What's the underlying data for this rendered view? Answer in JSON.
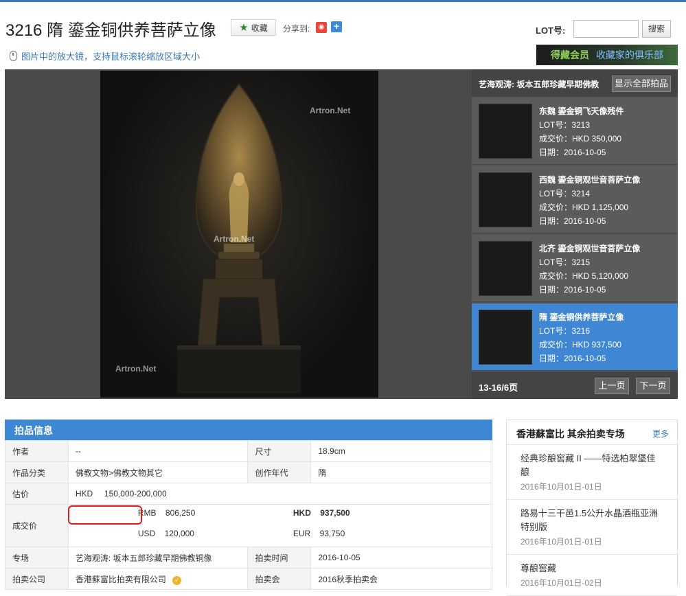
{
  "header": {
    "title": "3216 隋 鎏金铜供养菩萨立像",
    "fav_label": "收藏",
    "share_label": "分享到:",
    "lot_label": "LOT号:",
    "lot_value": "",
    "search_label": "搜索",
    "zoom_tip": "图片中的放大镜，支持鼠标滚轮缩放区域大小",
    "club_a": "得藏会员",
    "club_b": "收藏家的俱乐部"
  },
  "gallery": {
    "watermark": "Artron.Net",
    "side_title": "艺海观涛: 坂本五郎珍藏早期佛教",
    "show_all": "显示全部拍品",
    "items": [
      {
        "title": "东魏  鎏金铜飞天像残件",
        "lot": "LOT号：3213",
        "price": "成交价：HKD 350,000",
        "date": "日期：2016-10-05"
      },
      {
        "title": "西魏  鎏金铜观世音菩萨立像",
        "lot": "LOT号：3214",
        "price": "成交价：HKD 1,125,000",
        "date": "日期：2016-10-05"
      },
      {
        "title": "北齐  鎏金铜观世音菩萨立像",
        "lot": "LOT号：3215",
        "price": "成交价：HKD 5,120,000",
        "date": "日期：2016-10-05"
      },
      {
        "title": "隋  鎏金铜供养菩萨立像",
        "lot": "LOT号：3216",
        "price": "成交价：HKD 937,500",
        "date": "日期：2016-10-05"
      }
    ],
    "pager": "13-16/6页",
    "prev": "上一页",
    "next": "下一页"
  },
  "info": {
    "head": "拍品信息",
    "author_k": "作者",
    "author_v": "--",
    "size_k": "尺寸",
    "size_v": "18.9cm",
    "cat_k": "作品分类",
    "cat_v": "佛教文物>佛教文物其它",
    "era_k": "创作年代",
    "era_v": "隋",
    "est_k": "估价",
    "est_cur": "HKD",
    "est_v": "150,000-200,000",
    "deal_k": "成交价",
    "rmb_cur": "RMB",
    "rmb_v": "806,250",
    "hkd_cur": "HKD",
    "hkd_v": "937,500",
    "usd_cur": "USD",
    "usd_v": "120,000",
    "eur_cur": "EUR",
    "eur_v": "93,750",
    "session_k": "专场",
    "session_v": "艺海观涛: 坂本五郎珍藏早期佛教铜像",
    "time_k": "拍卖时间",
    "time_v": "2016-10-05",
    "company_k": "拍卖公司",
    "company_v": "香港蘇富比拍卖有限公司",
    "auction_k": "拍卖会",
    "auction_v": "2016秋季拍卖会"
  },
  "more": {
    "title": "香港蘇富比 其余拍卖专场",
    "link": "更多",
    "items": [
      {
        "name": "经典珍酿窖藏 II ——特选柏翠堡佳酿",
        "date": "2016年10月01日-01日"
      },
      {
        "name": "路易十三干邑1.5公升水晶酒瓶亚洲特别版",
        "date": "2016年10月01日-01日"
      },
      {
        "name": "尊酿窖藏",
        "date": "2016年10月01日-02日"
      }
    ]
  }
}
